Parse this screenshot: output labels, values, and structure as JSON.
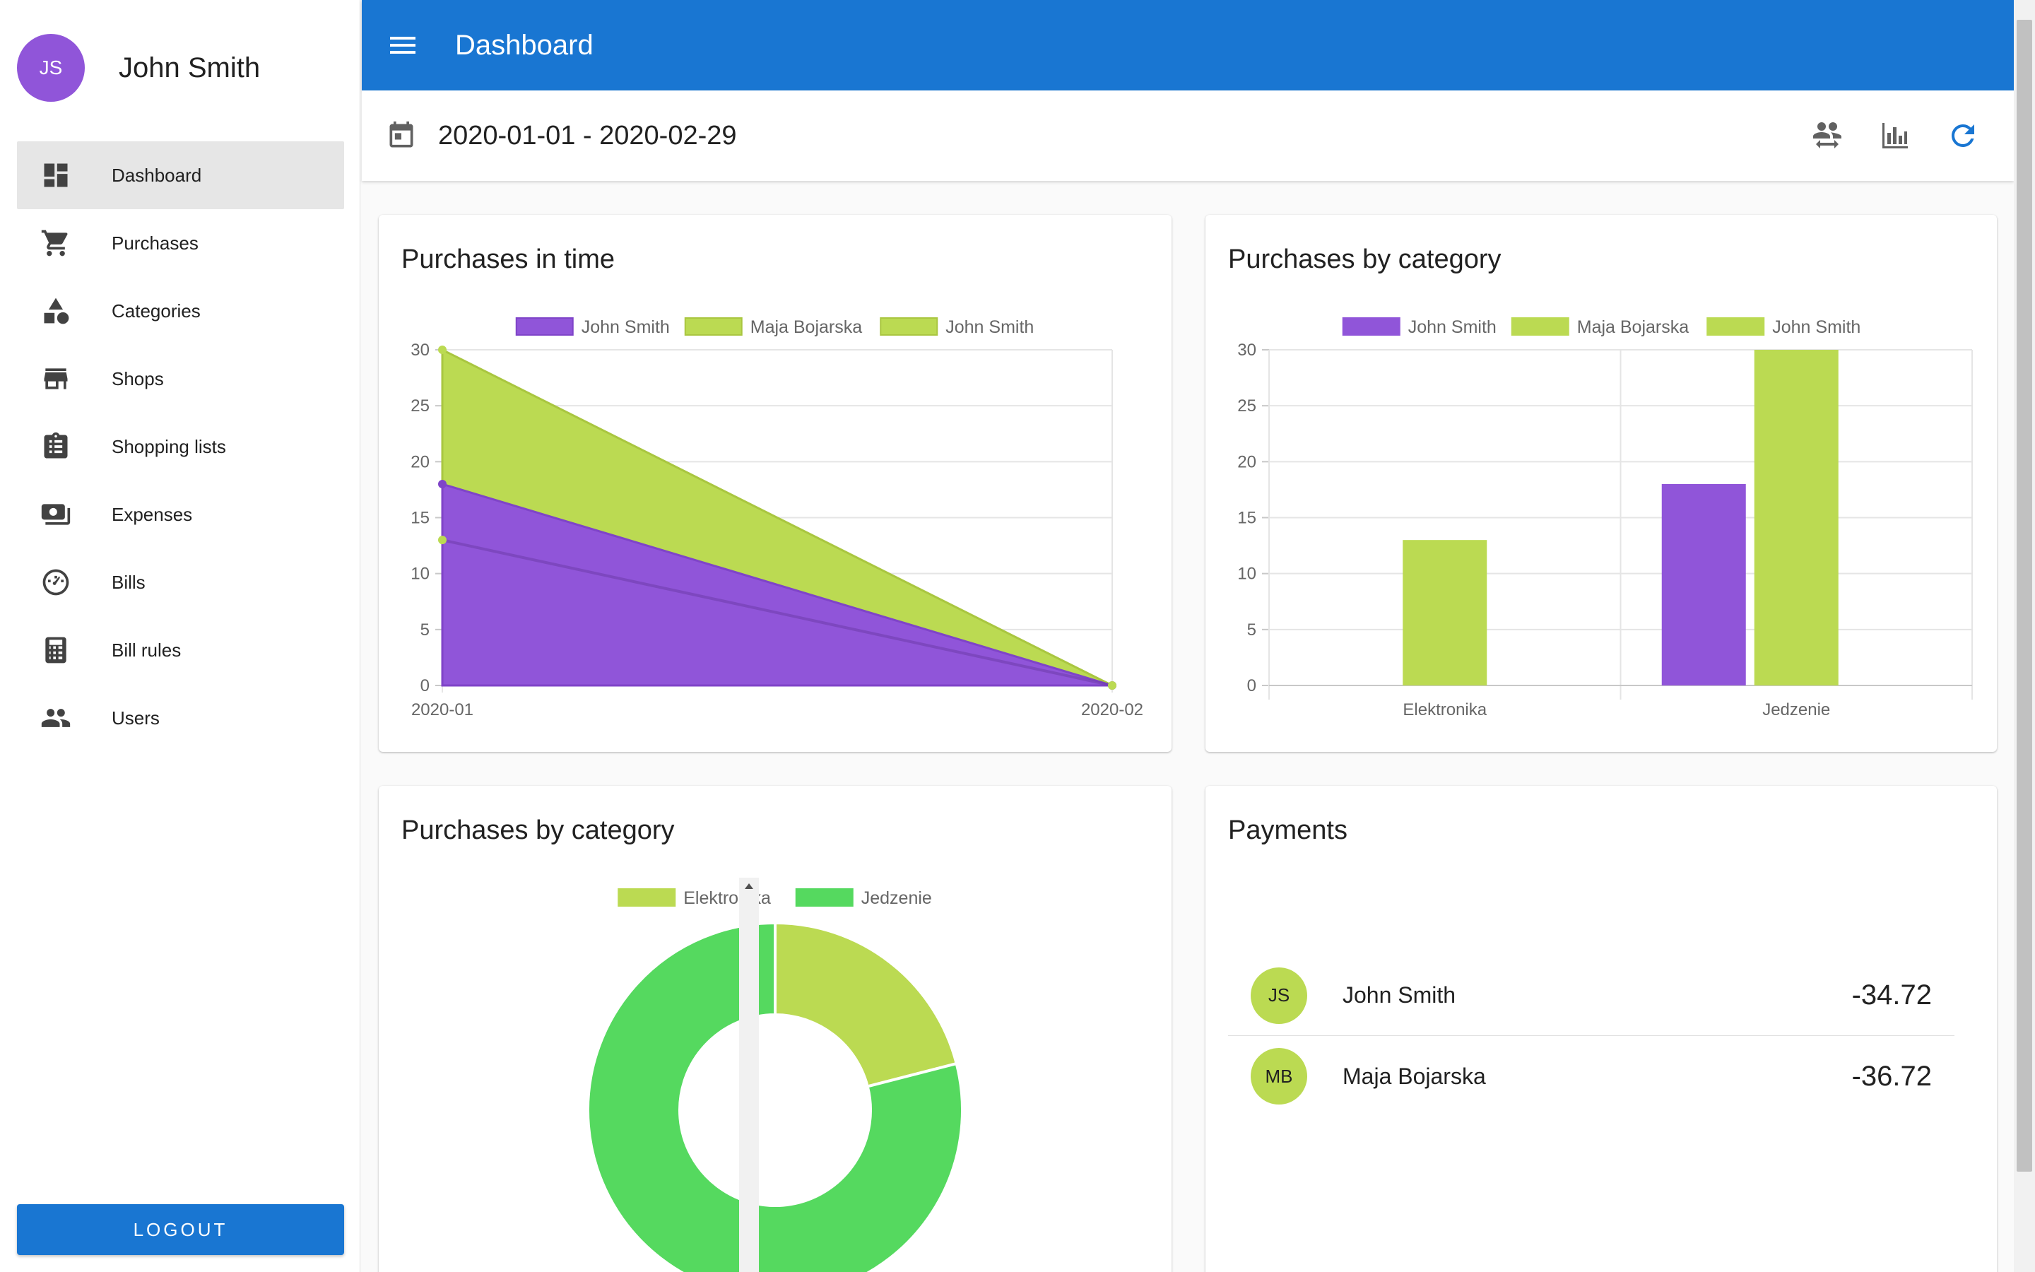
{
  "user": {
    "initials": "JS",
    "name": "John Smith",
    "avatar_color": "#9055d9"
  },
  "nav": [
    {
      "label": "Dashboard",
      "icon": "dashboard-icon",
      "active": true
    },
    {
      "label": "Purchases",
      "icon": "cart-icon"
    },
    {
      "label": "Categories",
      "icon": "categories-icon"
    },
    {
      "label": "Shops",
      "icon": "store-icon"
    },
    {
      "label": "Shopping lists",
      "icon": "clipboard-list-icon"
    },
    {
      "label": "Expenses",
      "icon": "money-icon"
    },
    {
      "label": "Bills",
      "icon": "gauge-icon"
    },
    {
      "label": "Bill rules",
      "icon": "calculator-icon"
    },
    {
      "label": "Users",
      "icon": "people-icon"
    }
  ],
  "logout_label": "LOGOUT",
  "appbar": {
    "title": "Dashboard",
    "menu_icon": "hamburger-menu-icon",
    "color": "#1976d2"
  },
  "toolbar": {
    "date_range": "2020-01-01 - 2020-02-29",
    "calendar_icon": "calendar-icon",
    "actions": [
      "users-transfer-icon",
      "bar-chart-icon",
      "refresh-icon"
    ]
  },
  "colors": {
    "purple": "#9055d9",
    "lime": "#bbda52",
    "green": "#55d95f"
  },
  "cards": {
    "time": {
      "title": "Purchases in time"
    },
    "category_bar": {
      "title": "Purchases by category"
    },
    "category_pie": {
      "title": "Purchases by category"
    },
    "payments": {
      "title": "Payments",
      "rows": [
        {
          "initials": "JS",
          "name": "John Smith",
          "amount": "-34.72"
        },
        {
          "initials": "MB",
          "name": "Maja Bojarska",
          "amount": "-36.72"
        }
      ]
    }
  },
  "chart_data": [
    {
      "type": "area",
      "title": "Purchases in time",
      "x": [
        "2020-01",
        "2020-02"
      ],
      "ylim": [
        0,
        30
      ],
      "yticks": [
        0,
        5,
        10,
        15,
        20,
        25,
        30
      ],
      "stacked": true,
      "series": [
        {
          "name": "John Smith",
          "color": "#9055d9",
          "values": [
            18,
            0
          ]
        },
        {
          "name": "Maja Bojarska",
          "color": "#bbda52",
          "values": [
            12,
            0
          ]
        },
        {
          "name": "John Smith",
          "color": "#bbda52",
          "values": [
            13,
            0
          ]
        }
      ],
      "grid": true,
      "legend": "top"
    },
    {
      "type": "bar",
      "title": "Purchases by category",
      "categories": [
        "Elektronika",
        "Jedzenie"
      ],
      "ylim": [
        0,
        30
      ],
      "yticks": [
        0,
        5,
        10,
        15,
        20,
        25,
        30
      ],
      "series": [
        {
          "name": "John Smith",
          "color": "#9055d9",
          "values": [
            0,
            18
          ]
        },
        {
          "name": "Maja Bojarska",
          "color": "#bbda52",
          "values": [
            13,
            30
          ]
        },
        {
          "name": "John Smith",
          "color": "#bbda52",
          "values": [
            0,
            0
          ]
        }
      ],
      "grid": true,
      "legend": "top"
    },
    {
      "type": "pie",
      "title": "Purchases by category",
      "donut": true,
      "slices": [
        {
          "label": "Elektronika",
          "value": 21,
          "color": "#bbda52"
        },
        {
          "label": "Jedzenie",
          "value": 79,
          "color": "#55d95f"
        }
      ],
      "legend": "top"
    }
  ]
}
